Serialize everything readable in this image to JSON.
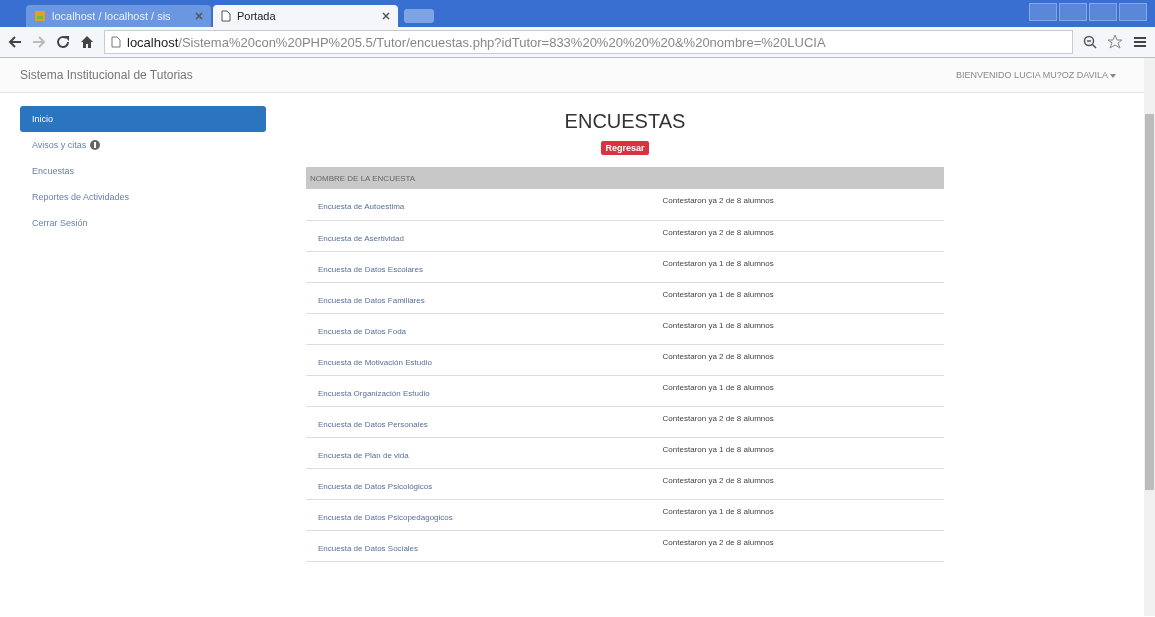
{
  "browser": {
    "tabs": [
      {
        "label": "localhost / localhost / sis",
        "selected": false
      },
      {
        "label": "Portada",
        "selected": true
      }
    ],
    "address": {
      "host": "localhost",
      "path": "/Sistema%20con%20PHP%205.5/Tutor/encuestas.php?idTutor=833%20%20%20%20&%20nombre=%20LUCIA"
    }
  },
  "navbar": {
    "brand": "Sistema Institucional de Tutorias",
    "user_menu": "BIENVENIDO LUCIA MU?OZ DAVILA"
  },
  "sidebar": {
    "items": [
      {
        "label": "Inicio",
        "selected": true,
        "kind": "plain"
      },
      {
        "label": "Avisos y citas",
        "selected": false,
        "kind": "badge"
      },
      {
        "label": "Encuestas",
        "selected": false,
        "kind": "plain"
      },
      {
        "label": "Reportes de Actividades",
        "selected": false,
        "kind": "plain"
      },
      {
        "label": "Cerrar Sesión",
        "selected": false,
        "kind": "plain"
      }
    ]
  },
  "main": {
    "title": "ENCUESTAS",
    "back_button": "Regresar",
    "table": {
      "columns": [
        "NOMBRE DE LA ENCUESTA"
      ],
      "rows": [
        {
          "name": "Encuesta de Autoestima",
          "status": "Contestaron ya 2 de 8 alumnos"
        },
        {
          "name": "Encuesta de Asertividad",
          "status": "Contestaron ya 2 de 8 alumnos"
        },
        {
          "name": "Encuesta de Datos Escolares",
          "status": "Contestaron ya 1 de 8 alumnos"
        },
        {
          "name": "Encuesta de Datos Familiares",
          "status": "Contestaron ya 1 de 8 alumnos"
        },
        {
          "name": "Encuesta de Datos Foda",
          "status": "Contestaron ya 1 de 8 alumnos"
        },
        {
          "name": "Encuesta de Motivación Estudio",
          "status": "Contestaron ya 2 de 8 alumnos"
        },
        {
          "name": "Encuesta Organización Estudio",
          "status": "Contestaron ya 1 de 8 alumnos"
        },
        {
          "name": "Encuesta de Datos Personales",
          "status": "Contestaron ya 2 de 8 alumnos"
        },
        {
          "name": "Encuesta de Plan de vida",
          "status": "Contestaron ya 1 de 8 alumnos"
        },
        {
          "name": "Encuesta de Datos Psicológicos",
          "status": "Contestaron ya 2 de 8 alumnos"
        },
        {
          "name": "Encuesta de Datos Psicopedagogicos",
          "status": "Contestaron ya 1 de 8 alumnos"
        },
        {
          "name": "Encuesta de Datos Sociales",
          "status": "Contestaron ya 2 de 8 alumnos"
        }
      ]
    }
  }
}
